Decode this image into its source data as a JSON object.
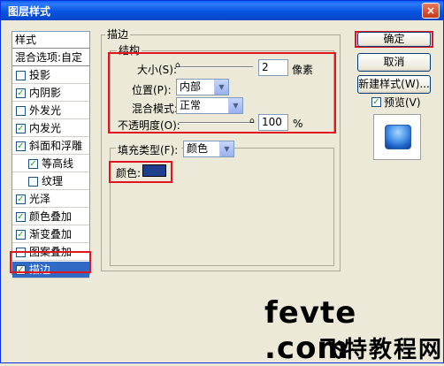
{
  "window": {
    "title": "图层样式",
    "close_label": "×"
  },
  "style_list": {
    "header": "样式",
    "blend_options": "混合选项:自定",
    "items": [
      {
        "label": "投影",
        "checked": false
      },
      {
        "label": "内阴影",
        "checked": true
      },
      {
        "label": "外发光",
        "checked": false
      },
      {
        "label": "内发光",
        "checked": true
      },
      {
        "label": "斜面和浮雕",
        "checked": true
      },
      {
        "label": "等高线",
        "checked": true
      },
      {
        "label": "纹理",
        "checked": false
      },
      {
        "label": "光泽",
        "checked": true
      },
      {
        "label": "颜色叠加",
        "checked": true
      },
      {
        "label": "渐变叠加",
        "checked": true
      },
      {
        "label": "图案叠加",
        "checked": false
      },
      {
        "label": "描边",
        "checked": true
      }
    ]
  },
  "stroke": {
    "group_title": "描边",
    "structure_title": "结构",
    "size_label": "大小(S):",
    "size_value": "2",
    "size_unit": "像素",
    "size_slider_fraction": 0.0,
    "position_label": "位置(P):",
    "position_value": "内部",
    "blend_label": "混合模式:",
    "blend_value": "正常",
    "opacity_label": "不透明度(O):",
    "opacity_value": "100",
    "opacity_unit": "%",
    "opacity_slider_fraction": 1.0,
    "fill_type_label": "填充类型(F):",
    "fill_type_value": "颜色",
    "color_label": "颜色:",
    "color_value": "#1e3f8c"
  },
  "buttons": {
    "ok": "确定",
    "cancel": "取消",
    "new_style": "新建样式(W)...",
    "preview_label": "预览(V)",
    "preview_checked": true
  },
  "watermark": {
    "line1": "fevte .com",
    "line2": "飞特教程网"
  }
}
